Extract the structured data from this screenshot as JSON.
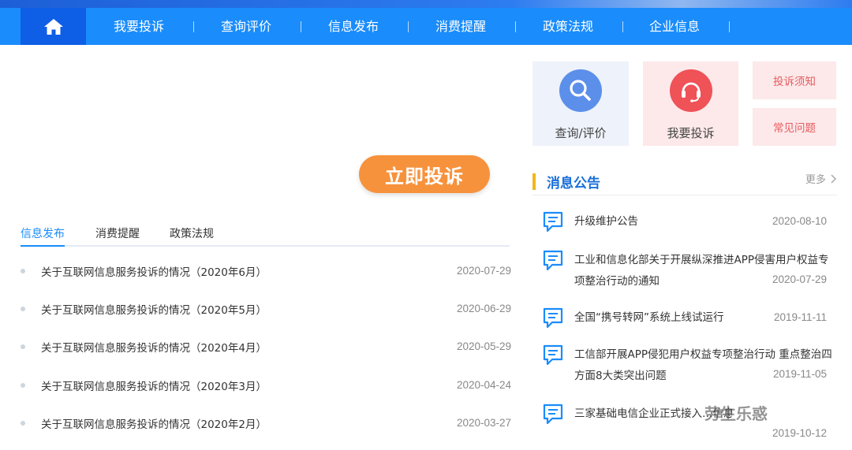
{
  "nav": {
    "items": [
      "我要投诉",
      "查询评价",
      "信息发布",
      "消费提醒",
      "政策法规",
      "企业信息"
    ]
  },
  "cta": {
    "label": "立即投诉"
  },
  "tabs": [
    "信息发布",
    "消费提醒",
    "政策法规"
  ],
  "news": [
    {
      "title": "关于互联网信息服务投诉的情况（2020年6月）",
      "date": "2020-07-29"
    },
    {
      "title": "关于互联网信息服务投诉的情况（2020年5月）",
      "date": "2020-06-29"
    },
    {
      "title": "关于互联网信息服务投诉的情况（2020年4月）",
      "date": "2020-05-29"
    },
    {
      "title": "关于互联网信息服务投诉的情况（2020年3月）",
      "date": "2020-04-24"
    },
    {
      "title": "关于互联网信息服务投诉的情况（2020年2月）",
      "date": "2020-03-27"
    }
  ],
  "tiles": {
    "query": "查询/评价",
    "complain": "我要投诉",
    "notice": "投诉须知",
    "faq": "常见问题"
  },
  "notices_header": {
    "title": "消息公告",
    "more": "更多"
  },
  "notices": [
    {
      "text": "升级维护公告",
      "date": "2020-08-10"
    },
    {
      "text": "工业和信息化部关于开展纵深推进APP侵害用户权益专项整治行动的通知",
      "date": "2020-07-29"
    },
    {
      "text": "全国“携号转网”系统上线试运行",
      "date": "2019-11-11"
    },
    {
      "text": "工信部开展APP侵犯用户权益专项整治行动 重点整治四方面8大类突出问题",
      "date": "2019-11-05"
    },
    {
      "text": "三家基础电信企业正式接入…信息服务投诉…",
      "date": "2019-10-12"
    }
  ],
  "watermark": "劳生乐惑",
  "colors": {
    "nav": "#1a8cfb",
    "home": "#0e5ee6",
    "cta": "#f7923c",
    "accent": "#f2b51c",
    "link": "#1a6fd9"
  },
  "icons": [
    "home-icon",
    "search-icon",
    "headset-icon",
    "message-icon",
    "chevron-right-icon"
  ]
}
